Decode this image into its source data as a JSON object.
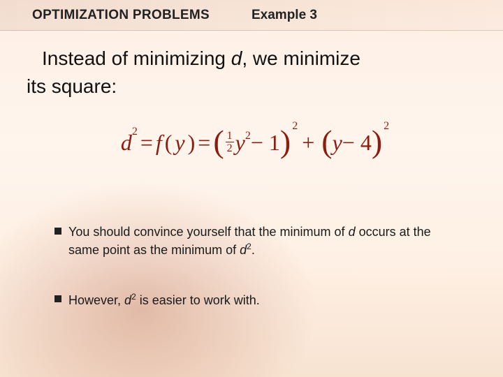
{
  "header": {
    "title": "OPTIMIZATION PROBLEMS",
    "example": "Example 3"
  },
  "lead": {
    "pre": "Instead of minimizing ",
    "var": "d",
    "post": ", we minimize",
    "line2": "its square:"
  },
  "equation": {
    "lhs_var": "d",
    "lhs_exp": "2",
    "eq1": " = ",
    "func": "f",
    "open": "(",
    "arg": "y",
    "close": ")",
    "eq2": " = ",
    "frac_num": "1",
    "frac_den": "2",
    "y": "y",
    "y_exp": "2",
    "minus1": " − 1",
    "outer_exp1": "2",
    "plus": " + ",
    "y2": "y",
    "minus4": " − 4",
    "outer_exp2": "2"
  },
  "bullets": {
    "b1_a": "You should convince yourself that the minimum of ",
    "b1_d": "d",
    "b1_b": " occurs at the same point as the minimum of ",
    "b1_d2": "d",
    "b1_exp": "2",
    "b1_c": ".",
    "b2_a": "However, ",
    "b2_d2": "d",
    "b2_exp": "2",
    "b2_b": " is easier to work with."
  }
}
